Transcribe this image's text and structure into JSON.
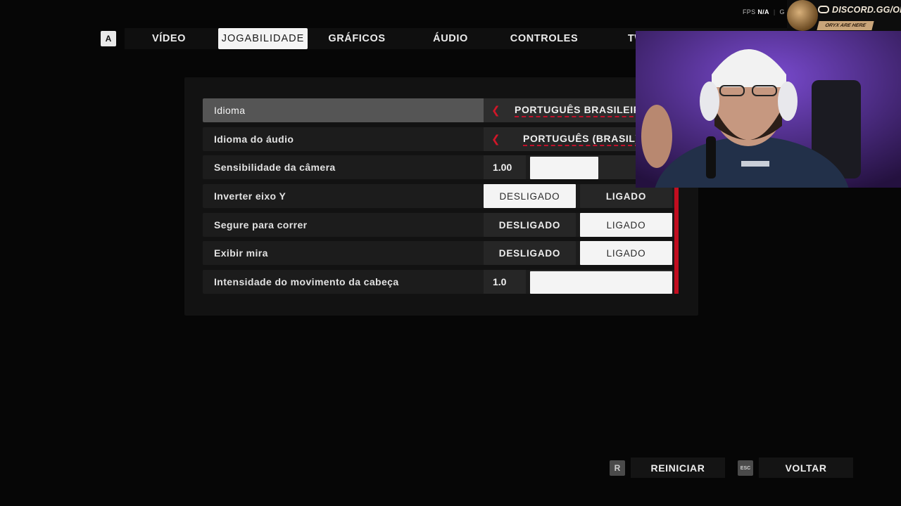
{
  "fps_overlay": {
    "label": "FPS",
    "value": "N/A",
    "extra": "G"
  },
  "top_nav": {
    "key_hint": "A",
    "tabs": [
      {
        "label": "VÍDEO",
        "active": false
      },
      {
        "label": "JOGABILIDADE",
        "active": true
      },
      {
        "label": "GRÁFICOS",
        "active": false
      },
      {
        "label": "ÁUDIO",
        "active": false
      },
      {
        "label": "CONTROLES",
        "active": false
      },
      {
        "label": "TWI",
        "active": false
      }
    ]
  },
  "settings": {
    "language": {
      "label": "Idioma",
      "value": "PORTUGUÊS BRASILEIR",
      "prev_arrow": "❮",
      "selected": true
    },
    "audio_language": {
      "label": "Idioma do áudio",
      "value": "PORTUGUÊS (BRASIL)",
      "prev_arrow": "❮"
    },
    "camera_sensitivity": {
      "label": "Sensibilidade da câmera",
      "value": "1.00",
      "fill_fraction": 0.5
    },
    "invert_y": {
      "label": "Inverter eixo Y",
      "off_label": "DESLIGADO",
      "on_label": "LIGADO",
      "state": "off"
    },
    "hold_to_run": {
      "label": "Segure para correr",
      "off_label": "DESLIGADO",
      "on_label": "LIGADO",
      "state": "on"
    },
    "show_crosshair": {
      "label": "Exibir mira",
      "off_label": "DESLIGADO",
      "on_label": "LIGADO",
      "state": "on"
    },
    "head_bob": {
      "label": "Intensidade do movimento da cabeça",
      "value": "1.0",
      "fill_fraction": 1.0
    }
  },
  "actions": {
    "reset": {
      "key": "R",
      "label": "REINICIAR"
    },
    "back": {
      "key": "ESC",
      "label": "VOLTAR"
    }
  },
  "stream_overlay": {
    "discord_text": "DISCORD.GG/ORYX",
    "tagline": "ORYX ARE HERE"
  },
  "colors": {
    "accent_red": "#c20d1f",
    "selected_row": "#555555",
    "toggle_active": "#f4f4f4"
  }
}
